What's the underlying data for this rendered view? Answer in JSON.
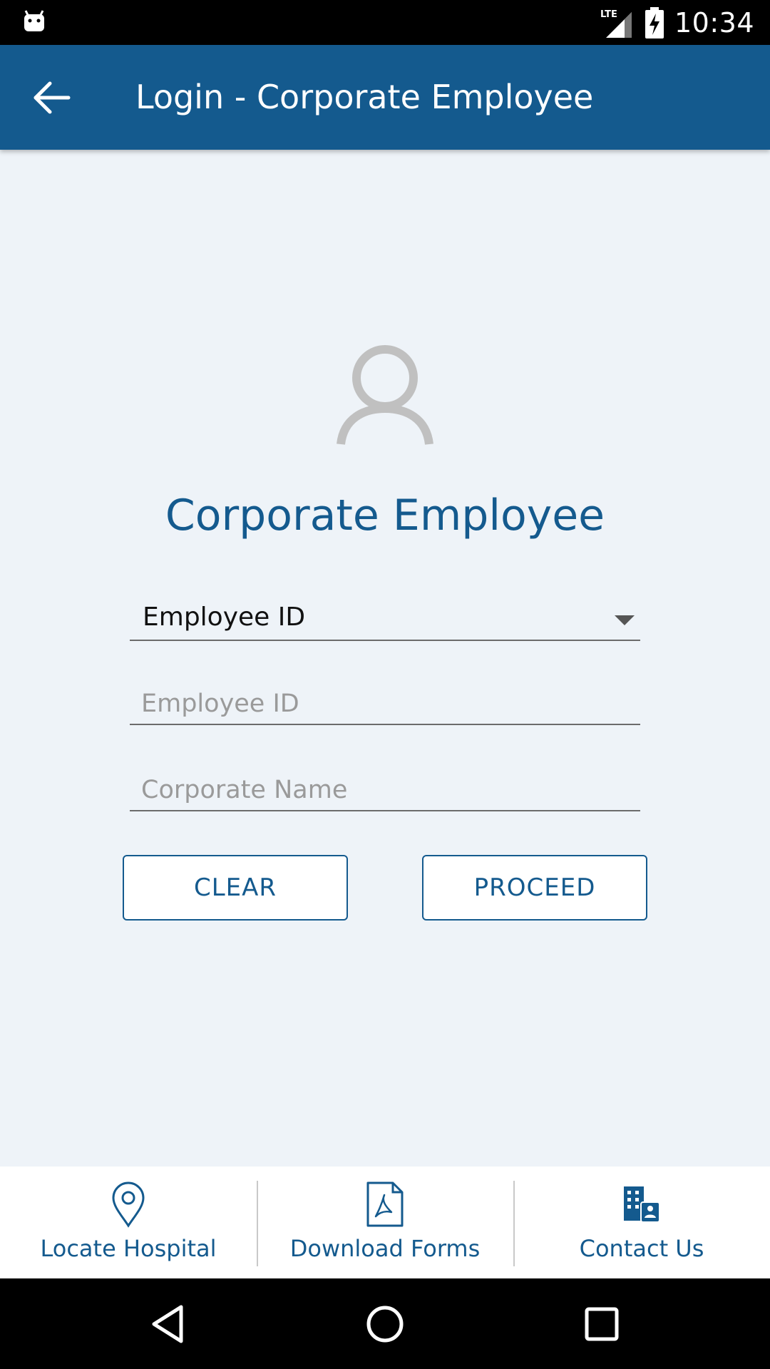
{
  "status_bar": {
    "time": "10:34",
    "network": "LTE",
    "icons": [
      "android-debug-icon",
      "lte-signal-icon",
      "battery-charging-icon"
    ]
  },
  "app_bar": {
    "title": "Login - Corporate Employee",
    "back_icon": "arrow-left-icon"
  },
  "main": {
    "avatar_icon": "user-outline-icon",
    "heading": "Corporate Employee",
    "login_type": {
      "selected": "Employee ID"
    },
    "employee_id": {
      "value": "",
      "placeholder": "Employee ID"
    },
    "corporate_name": {
      "value": "",
      "placeholder": "Corporate Name"
    },
    "buttons": {
      "clear_label": "CLEAR",
      "proceed_label": "PROCEED"
    }
  },
  "bottom_nav": {
    "items": [
      {
        "label": "Locate Hospital",
        "icon": "map-pin-icon"
      },
      {
        "label": "Download Forms",
        "icon": "pdf-file-icon"
      },
      {
        "label": "Contact Us",
        "icon": "building-contact-icon"
      }
    ]
  },
  "colors": {
    "primary": "#145a8e",
    "background": "#eef3f8",
    "status_bar": "#000000",
    "placeholder": "#9a9a9a",
    "avatar": "#c0c0c0"
  }
}
